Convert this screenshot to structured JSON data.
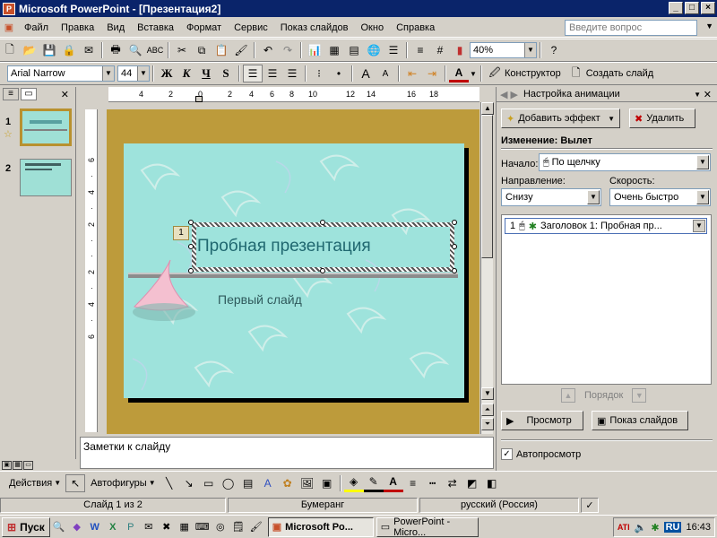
{
  "window": {
    "title": "Microsoft PowerPoint - [Презентация2]",
    "app_icon": "P"
  },
  "menu": {
    "items": [
      "Файл",
      "Правка",
      "Вид",
      "Вставка",
      "Формат",
      "Сервис",
      "Показ слайдов",
      "Окно",
      "Справка"
    ],
    "ask_placeholder": "Введите вопрос"
  },
  "toolbar_std": {
    "zoom": "40%"
  },
  "toolbar_fmt": {
    "font": "Arial Narrow",
    "size": "44",
    "bold": "Ж",
    "italic": "К",
    "underline": "Ч",
    "shadow": "S",
    "designer": "Конструктор",
    "new_slide": "Создать слайд"
  },
  "left_panel": {
    "slides": [
      {
        "num": "1"
      },
      {
        "num": "2"
      }
    ]
  },
  "ruler": {
    "ticks": [
      "4",
      "2",
      "0",
      "2",
      "4",
      "6",
      "8",
      "10",
      "12",
      "14",
      "16",
      "18"
    ]
  },
  "slide": {
    "title": "Пробная презентация",
    "subtitle": "Первый слайд",
    "anim_tag": "1"
  },
  "notes": {
    "text": "Заметки к слайду"
  },
  "task_pane": {
    "title": "Настройка анимации",
    "add_effect": "Добавить эффект",
    "remove": "Удалить",
    "change_label": "Изменение: Вылет",
    "start_label": "Начало:",
    "start_value": "По щелчку",
    "direction_label": "Направление:",
    "direction_value": "Снизу",
    "speed_label": "Скорость:",
    "speed_value": "Очень быстро",
    "anim_item": {
      "index": "1",
      "text": "Заголовок 1: Пробная пр..."
    },
    "order_label": "Порядок",
    "preview": "Просмотр",
    "slideshow": "Показ слайдов",
    "autopreview": "Автопросмотр"
  },
  "draw_toolbar": {
    "actions": "Действия",
    "autoshapes": "Автофигуры"
  },
  "status": {
    "slide": "Слайд 1 из 2",
    "design": "Бумеранг",
    "lang": "русский (Россия)"
  },
  "taskbar": {
    "start": "Пуск",
    "tasks": [
      "Microsoft Po...",
      "PowerPoint - Micro..."
    ],
    "lang": "RU",
    "time": "16:43"
  }
}
